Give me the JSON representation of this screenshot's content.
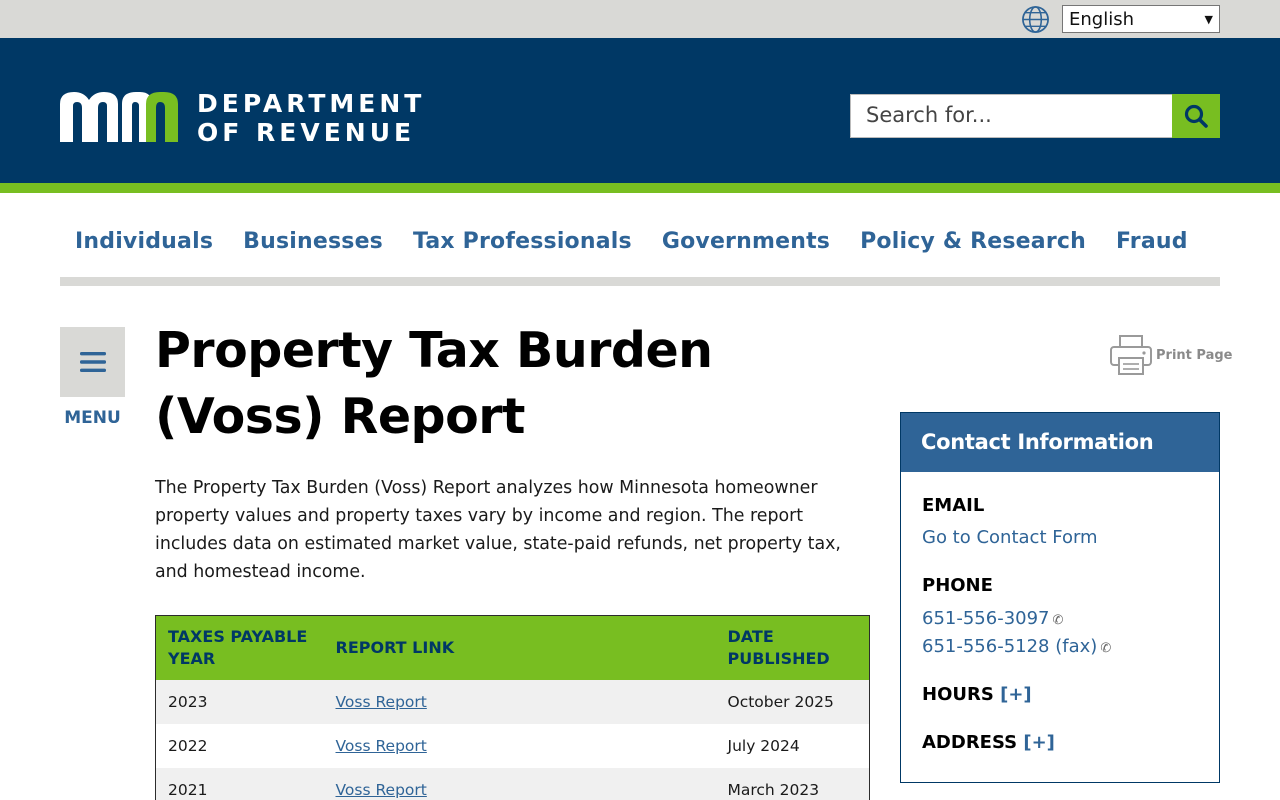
{
  "utility": {
    "language_selected": "English"
  },
  "header": {
    "logo_line1": "DEPARTMENT",
    "logo_line2": "OF REVENUE",
    "search_placeholder": "Search for..."
  },
  "nav": {
    "items": [
      "Individuals",
      "Businesses",
      "Tax Professionals",
      "Governments",
      "Policy & Research",
      "Fraud"
    ]
  },
  "menu": {
    "label": "MENU"
  },
  "page": {
    "title": "Property Tax Burden (Voss) Report",
    "intro": "The Property Tax Burden (Voss) Report analyzes how Minnesota homeowner property values and property taxes vary by income and region. The report includes data on estimated market value, state-paid refunds, net property tax, and homestead income."
  },
  "table": {
    "headers": [
      "TAXES PAYABLE YEAR",
      "REPORT LINK",
      "DATE PUBLISHED"
    ],
    "rows": [
      {
        "year": "2023",
        "link": "Voss Report",
        "date": "October 2025"
      },
      {
        "year": "2022",
        "link": "Voss Report",
        "date": "July 2024"
      },
      {
        "year": "2021",
        "link": "Voss Report",
        "date": "March 2023"
      }
    ]
  },
  "print": {
    "label": "Print Page"
  },
  "contact": {
    "title": "Contact Information",
    "email_label": "EMAIL",
    "email_link": "Go to Contact Form",
    "phone_label": "PHONE",
    "phone1": "651-556-3097",
    "phone2": "651-556-5128 (fax)",
    "hours_label": "HOURS",
    "address_label": "ADDRESS",
    "expand": "[+]"
  },
  "colors": {
    "header_blue": "#003865",
    "accent_green": "#78be21",
    "link_blue": "#2f6497",
    "utility_gray": "#d9d9d6"
  }
}
